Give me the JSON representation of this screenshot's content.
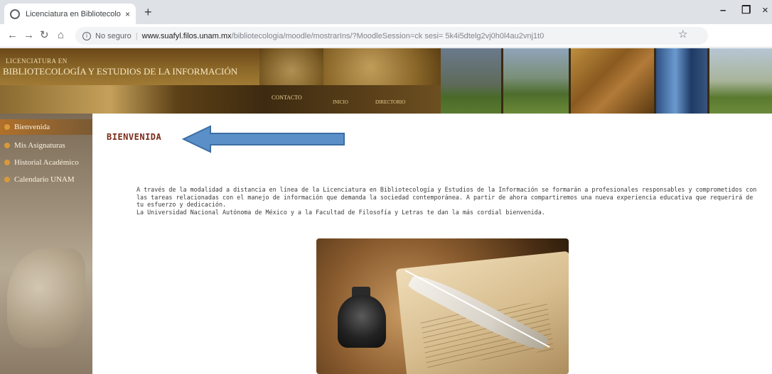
{
  "browser": {
    "tab_title": "Licenciatura en Bibliotecología y",
    "tab_close": "×",
    "new_tab": "+",
    "window_minimize": "–",
    "window_maximize": "❐",
    "window_close": "×",
    "security_label": "No seguro",
    "url_host": "www.suafyl.filos.unam.mx",
    "url_path": "/bibliotecologia/moodle/mostrarIns/?MoodleSession=ck sesi= 5k4i5dtelg2vj0h0l4au2vnj1t0"
  },
  "banner": {
    "kicker": "LICENCIATURA EN",
    "title": "BIBLIOTECOLOGÍA Y ESTUDIOS DE LA INFORMACIÓN",
    "contact": "CONTACTO",
    "small_links": [
      "INICIO",
      "DIRECTORIO"
    ]
  },
  "sidebar": {
    "items": [
      {
        "label": "Bienvenida"
      },
      {
        "label": "Mis Asignaturas"
      },
      {
        "label": "Historial Académico"
      },
      {
        "label": "Calendario UNAM"
      }
    ]
  },
  "main": {
    "title": "BIENVENIDA",
    "intro_paragraph": "A través de la modalidad a distancia en línea de la Licenciatura en Bibliotecología y Estudios de la Información se formarán a profesionales responsables y comprometidos con las tareas relacionadas con el manejo de información que demanda la sociedad contemporánea. A partir de ahora compartiremos una nueva experiencia educativa que requerirá de tu esfuerzo y dedicación.",
    "welcome_line": "La Universidad Nacional Autónoma de México y a la Facultad de Filosofía y Letras te dan la más cordial bienvenida."
  },
  "colors": {
    "title_color": "#7a2a1a",
    "arrow_fill": "#5b8fc8",
    "arrow_stroke": "#3d6ea4",
    "nav_active": "#b0702a"
  },
  "icons": [
    "back-arrow-icon",
    "forward-arrow-icon",
    "reload-icon",
    "home-icon",
    "info-icon",
    "star-icon",
    "globe-icon"
  ]
}
